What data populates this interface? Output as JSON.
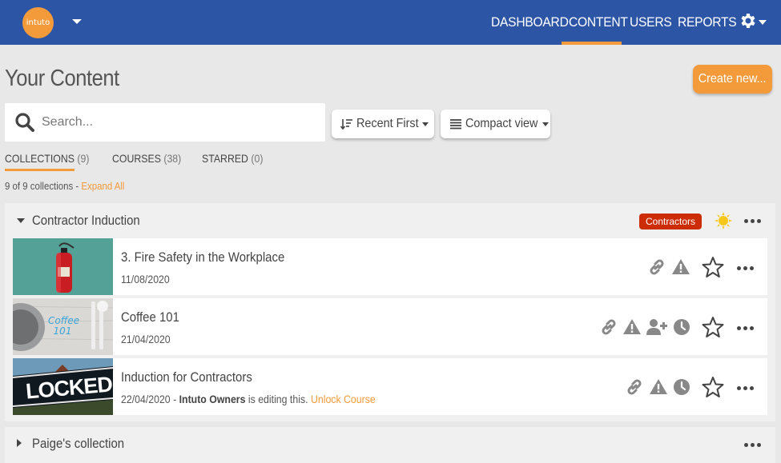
{
  "app": {
    "logo_text": "intuto"
  },
  "nav": {
    "dashboard": "DASHBOARD",
    "content": "CONTENT",
    "users": "USERS",
    "reports": "REPORTS",
    "active": "CONTENT"
  },
  "page": {
    "title": "Your Content",
    "create_label": "Create new..."
  },
  "search": {
    "placeholder": "Search..."
  },
  "controls": {
    "sort_label": "Recent First",
    "view_label": "Compact view"
  },
  "tabs": [
    {
      "label": "COLLECTIONS",
      "count": "(9)"
    },
    {
      "label": "COURSES",
      "count": "(38)"
    },
    {
      "label": "STARRED",
      "count": "(0)"
    }
  ],
  "summary": {
    "text": "9 of 9 collections - ",
    "link": "Expand All"
  },
  "collections": [
    {
      "title": "Contractor Induction",
      "badge": "Contractors",
      "courses": [
        {
          "title": "3. Fire Safety in the Workplace",
          "date": "11/08/2020",
          "thumb_text": ""
        },
        {
          "title": "Coffee 101",
          "date": "21/04/2020",
          "thumb_text": "Coffee 101"
        },
        {
          "title": "Induction for Contractors",
          "date": "22/04/2020",
          "editor_prefix": " - ",
          "editor": "Intuto Owners",
          "editor_suffix": " is editing this. ",
          "unlock": "Unlock Course",
          "thumb_text": "LOCKED"
        }
      ]
    },
    {
      "title": "Paige's collection"
    }
  ],
  "colors": {
    "nav_bg": "#2d55a6",
    "accent": "#f39a3b",
    "badge_red": "#cc2d07"
  }
}
